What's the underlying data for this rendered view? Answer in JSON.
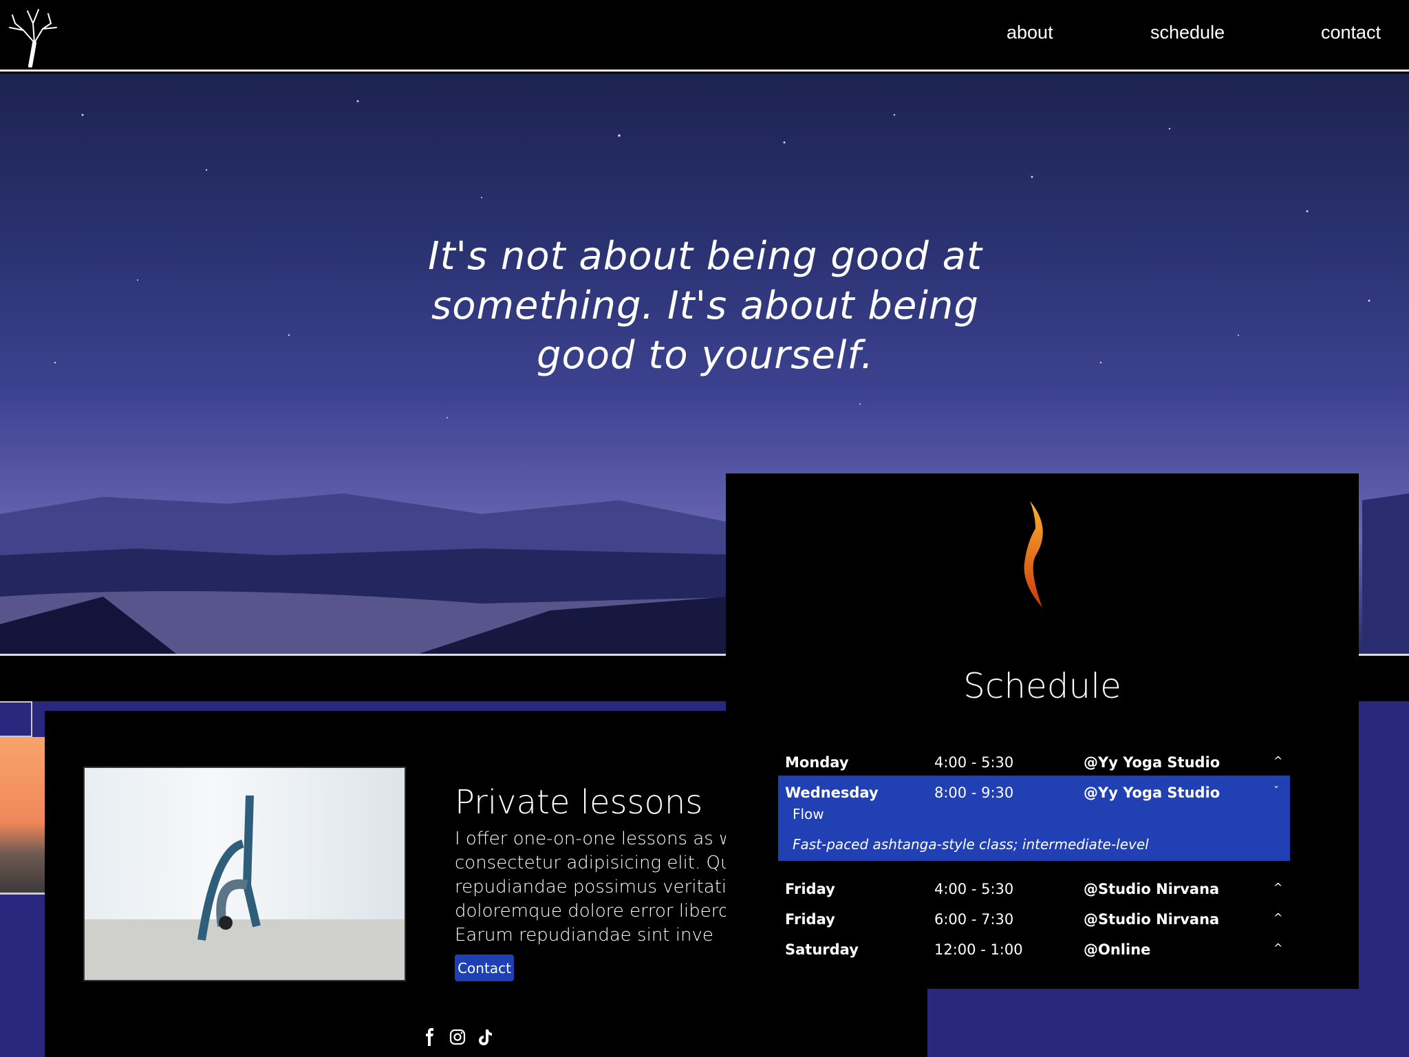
{
  "header": {
    "logo": "tree-logo",
    "nav": [
      {
        "label": "about"
      },
      {
        "label": "schedule"
      },
      {
        "label": "contact"
      }
    ]
  },
  "hero": {
    "quote": "It's not about being good at something. It's about being good to yourself."
  },
  "lessons": {
    "title": "Private lessons",
    "lines": [
      "I offer one-on-one lessons as well as",
      "consectetur adipisicing elit. Quod s",
      "repudiandae possimus veritatis su",
      "doloremque dolore error libero na",
      "Earum repudiandae sint inve"
    ],
    "button": "Contact",
    "social": [
      "facebook-icon",
      "instagram-icon",
      "tiktok-icon"
    ]
  },
  "schedule": {
    "title": "Schedule",
    "rows": [
      {
        "day": "Monday",
        "time": "4:00 - 5:30",
        "location": "@Yy Yoga Studio",
        "chevron": "^"
      },
      {
        "day": "Wednesday",
        "time": "8:00 - 9:30",
        "location": "@Yy Yoga Studio",
        "chevron": "ˇ",
        "expanded": true,
        "class": "Flow",
        "description": "Fast-paced ashtanga-style class; intermediate-level"
      },
      {
        "day": "Friday",
        "time": "4:00 - 5:30",
        "location": "@Studio Nirvana",
        "chevron": "^"
      },
      {
        "day": "Friday",
        "time": "6:00 - 7:30",
        "location": "@Studio Nirvana",
        "chevron": "^"
      },
      {
        "day": "Saturday",
        "time": "12:00 - 1:00",
        "location": "@Online",
        "chevron": "^"
      }
    ]
  },
  "colors": {
    "accent": "#2040b4",
    "band": "#29287e",
    "background": "#000000"
  }
}
